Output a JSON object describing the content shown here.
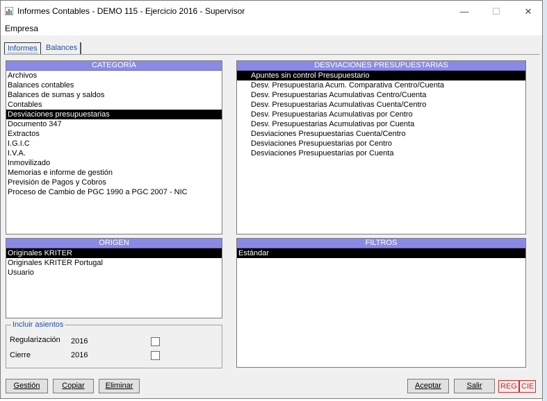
{
  "window": {
    "title": "Informes Contables - DEMO 115 - Ejercicio 2016 - Supervisor",
    "controls": {
      "minimize": "—",
      "maximize": "☐",
      "close": "✕"
    }
  },
  "menu": {
    "items": [
      "Empresa"
    ]
  },
  "tabs": [
    {
      "label": "Informes",
      "active": true
    },
    {
      "label": "Balances",
      "active": false
    }
  ],
  "categoria": {
    "header": "CATEGORÍA",
    "selected_index": 4,
    "items": [
      "Archivos",
      "Balances contables",
      "Balances de sumas y saldos",
      "Contables",
      "Desviaciones presupuestarias",
      "Documento 347",
      "Extractos",
      "I.G.I.C",
      "I.V.A.",
      "Inmovilizado",
      "Memorias e informe de gestión",
      "Previsión de Pagos y Cobros",
      "Proceso de Cambio de PGC 1990 a PGC 2007 - NIC"
    ]
  },
  "desviaciones": {
    "header": "DESVIACIONES PRESUPUESTARIAS",
    "selected_index": 0,
    "items": [
      "Apuntes sin control Presupuestario",
      "Desv. Presupuestaria Acum. Comparativa Centro/Cuenta",
      "Desv. Presupuestarias Acumulativas Centro/Cuenta",
      "Desv. Presupuestarias Acumulativas Cuenta/Centro",
      "Desv. Presupuestarias Acumulativas por Centro",
      "Desv. Presupuestarias Acumulativas por Cuenta",
      "Desviaciones Presupuestarias Cuenta/Centro",
      "Desviaciones Presupuestarias por Centro",
      "Desviaciones Presupuestarias por Cuenta"
    ]
  },
  "origen": {
    "header": "ORIGEN",
    "selected_index": 0,
    "items": [
      "Originales KRITER",
      "Originales KRITER Portugal",
      "Usuario"
    ]
  },
  "filtros": {
    "header": "FILTROS",
    "selected_index": 0,
    "items": [
      "Estándar"
    ]
  },
  "incluir": {
    "legend": "Incluir asientos",
    "rows": [
      {
        "label": "Regularización",
        "year": "2016",
        "checked": false
      },
      {
        "label": "Cierre",
        "year": "2016",
        "checked": false
      }
    ]
  },
  "buttons": {
    "gestion": "Gestión",
    "copiar": "Copiar",
    "eliminar": "Eliminar",
    "aceptar": "Aceptar",
    "salir": "Salir"
  },
  "badges": {
    "reg": "REG",
    "cie": "CIE"
  },
  "colors": {
    "panel_header": "#8a8ae6",
    "selection": "#000000",
    "accent": "#1d50a8",
    "badge": "#dd2222"
  }
}
